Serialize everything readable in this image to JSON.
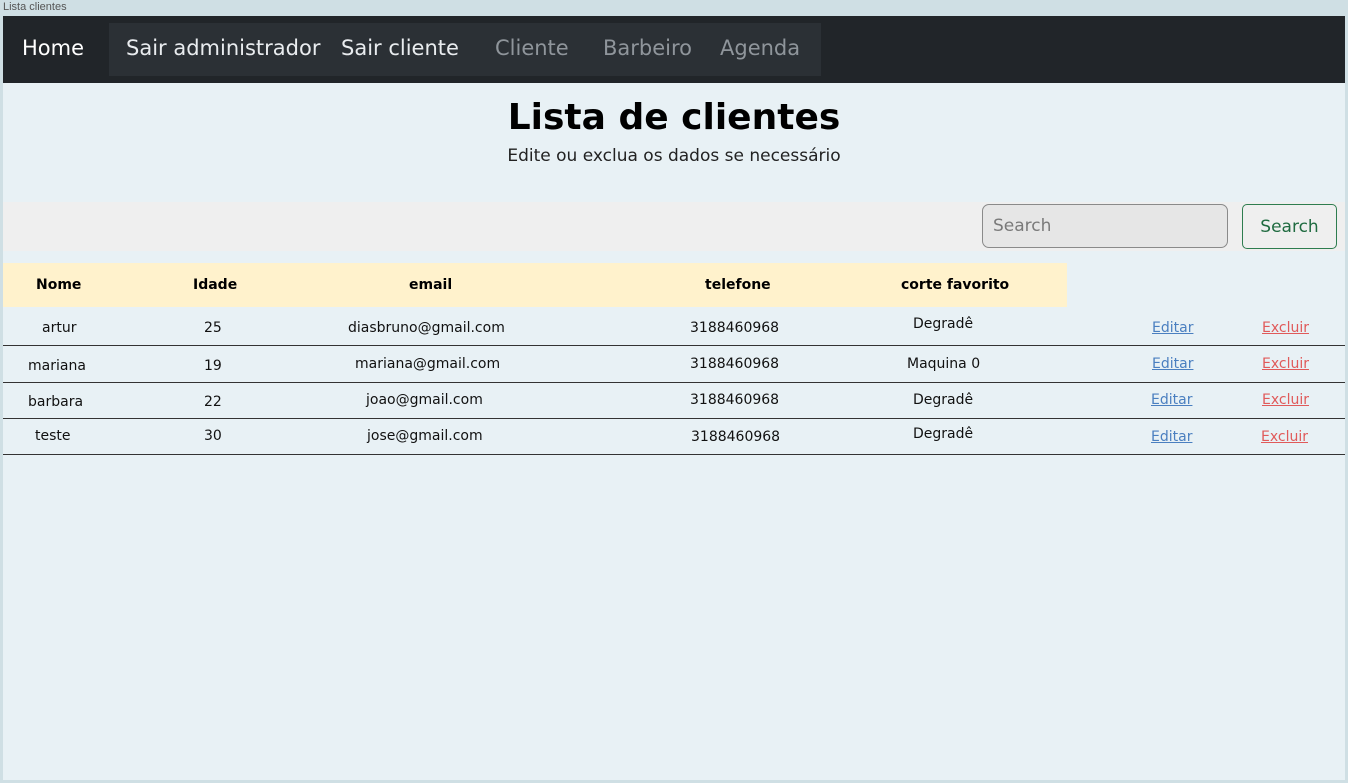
{
  "window": {
    "title": "Lista clientes"
  },
  "navbar": {
    "home": "Home",
    "items": [
      {
        "label": "Sair administrador"
      },
      {
        "label": "Sair cliente"
      },
      {
        "label": "Cliente"
      },
      {
        "label": "Barbeiro"
      },
      {
        "label": "Agenda"
      }
    ]
  },
  "header": {
    "title": "Lista de clientes",
    "subtitle": "Edite ou exclua os dados se necessário"
  },
  "search": {
    "placeholder": "Search",
    "value": "",
    "button_label": "Search"
  },
  "table": {
    "columns": [
      "Nome",
      "Idade",
      "email",
      "telefone",
      "corte favorito"
    ],
    "rows": [
      {
        "nome": "artur",
        "idade": "25",
        "email": "diasbruno@gmail.com",
        "telefone": "3188460968",
        "corte": "Degradê",
        "edit": "Editar",
        "delete": "Excluir"
      },
      {
        "nome": "mariana",
        "idade": "19",
        "email": "mariana@gmail.com",
        "telefone": "3188460968",
        "corte": "Maquina 0",
        "edit": "Editar",
        "delete": "Excluir"
      },
      {
        "nome": "barbara",
        "idade": "22",
        "email": "joao@gmail.com",
        "telefone": "3188460968",
        "corte": "Degradê",
        "edit": "Editar",
        "delete": "Excluir"
      },
      {
        "nome": "teste",
        "idade": "30",
        "email": "jose@gmail.com",
        "telefone": "3188460968",
        "corte": "Degradê",
        "edit": "Editar",
        "delete": "Excluir"
      }
    ]
  },
  "colors": {
    "navbar_bg": "#212529",
    "page_bg": "#e8f1f5",
    "header_row_bg": "#fff2cc",
    "search_button": "#1f6b40",
    "edit_link": "#4a7fc0",
    "delete_link": "#e05a5a"
  }
}
